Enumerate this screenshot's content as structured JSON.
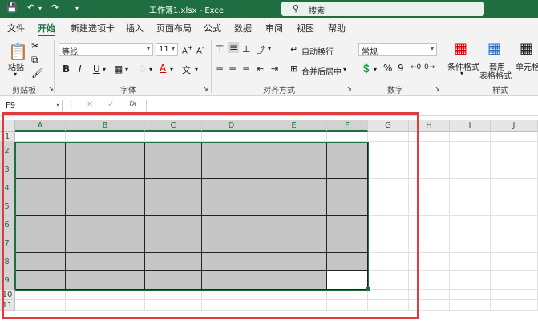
{
  "titlebar": {
    "filename": "工作簿1.xlsx",
    "sep": "-",
    "app": "Excel",
    "search_placeholder": "搜索"
  },
  "tabs": [
    "文件",
    "开始",
    "新建选项卡",
    "插入",
    "页面布局",
    "公式",
    "数据",
    "审阅",
    "视图",
    "帮助"
  ],
  "ribbon": {
    "paste": "粘贴",
    "clipboard": "剪贴板",
    "font_name": "等线",
    "font_size": "11",
    "font_group": "字体",
    "wrap_text": "自动换行",
    "merge_center": "合并后居中",
    "align_group": "对齐方式",
    "number_format": "常规",
    "number_group": "数字",
    "cond_format": "条件格式",
    "table_format_1": "套用",
    "table_format_2": "表格格式",
    "cell_style": "单元格",
    "style_group": "样式",
    "bold": "B",
    "italic": "I",
    "underline": "U",
    "pct": "%",
    "comma": "9"
  },
  "formula_bar": {
    "namebox": "F9",
    "cancel": "✕",
    "enter": "✓",
    "fx": "fx"
  },
  "columns": [
    "A",
    "B",
    "C",
    "D",
    "E",
    "F",
    "G",
    "H",
    "I",
    "J"
  ],
  "rows": [
    "1",
    "2",
    "3",
    "4",
    "5",
    "6",
    "7",
    "8",
    "9",
    "10",
    "11"
  ],
  "colors": {
    "excel_green": "#1e6e42",
    "highlight_red": "#e23b3b",
    "cell_gray": "#c6c6c6"
  }
}
